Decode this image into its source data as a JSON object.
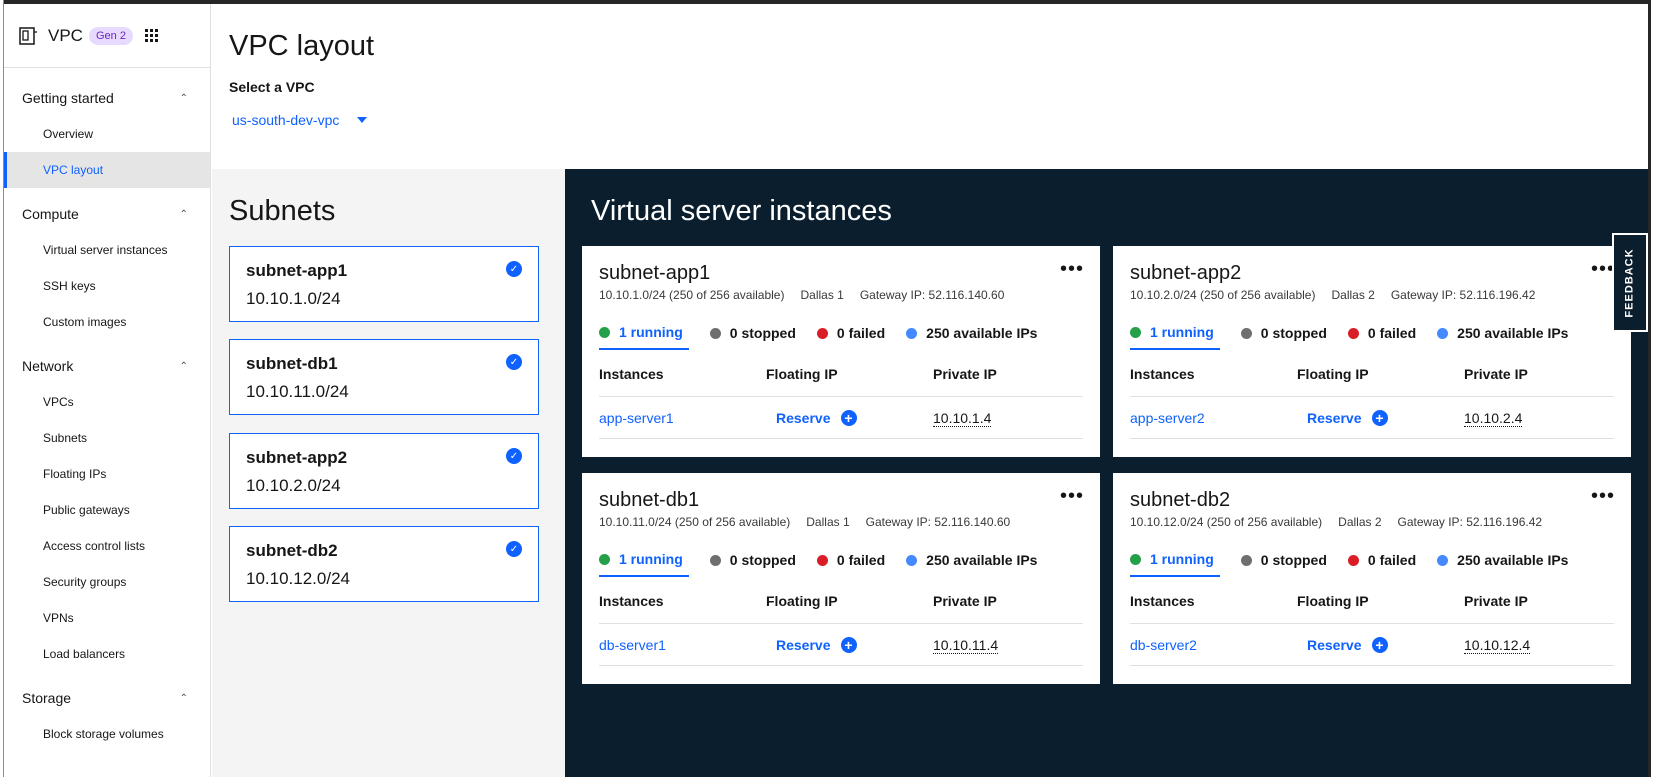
{
  "app": {
    "title": "VPC",
    "badge": "Gen 2"
  },
  "sidebar": {
    "sections": [
      {
        "label": "Getting started",
        "items": [
          {
            "label": "Overview"
          },
          {
            "label": "VPC layout"
          }
        ]
      },
      {
        "label": "Compute",
        "items": [
          {
            "label": "Virtual server instances"
          },
          {
            "label": "SSH keys"
          },
          {
            "label": "Custom images"
          }
        ]
      },
      {
        "label": "Network",
        "items": [
          {
            "label": "VPCs"
          },
          {
            "label": "Subnets"
          },
          {
            "label": "Floating IPs"
          },
          {
            "label": "Public gateways"
          },
          {
            "label": "Access control lists"
          },
          {
            "label": "Security groups"
          },
          {
            "label": "VPNs"
          },
          {
            "label": "Load balancers"
          }
        ]
      },
      {
        "label": "Storage",
        "items": [
          {
            "label": "Block storage volumes"
          }
        ]
      }
    ],
    "active_item": "VPC layout"
  },
  "page": {
    "title": "VPC layout",
    "select_label": "Select a VPC",
    "selected_vpc": "us-south-dev-vpc"
  },
  "subnets": {
    "title": "Subnets",
    "items": [
      {
        "name": "subnet-app1",
        "cidr": "10.10.1.0/24"
      },
      {
        "name": "subnet-db1",
        "cidr": "10.10.11.0/24"
      },
      {
        "name": "subnet-app2",
        "cidr": "10.10.2.0/24"
      },
      {
        "name": "subnet-db2",
        "cidr": "10.10.12.0/24"
      }
    ]
  },
  "vsi": {
    "title": "Virtual server instances",
    "table_headers": {
      "instances": "Instances",
      "floating_ip": "Floating IP",
      "private_ip": "Private IP"
    },
    "reserve_label": "Reserve",
    "cards": [
      {
        "name": "subnet-app1",
        "cidr": "10.10.1.0/24 (250 of 256 available)",
        "zone": "Dallas 1",
        "gateway": "Gateway IP: 52.116.140.60",
        "running": "1 running",
        "stopped": "0 stopped",
        "failed": "0 failed",
        "available": "250 available IPs",
        "instance": "app-server1",
        "private_ip": "10.10.1.4"
      },
      {
        "name": "subnet-app2",
        "cidr": "10.10.2.0/24 (250 of 256 available)",
        "zone": "Dallas 2",
        "gateway": "Gateway IP: 52.116.196.42",
        "running": "1 running",
        "stopped": "0 stopped",
        "failed": "0 failed",
        "available": "250 available IPs",
        "instance": "app-server2",
        "private_ip": "10.10.2.4"
      },
      {
        "name": "subnet-db1",
        "cidr": "10.10.11.0/24 (250 of 256 available)",
        "zone": "Dallas 1",
        "gateway": "Gateway IP: 52.116.140.60",
        "running": "1 running",
        "stopped": "0 stopped",
        "failed": "0 failed",
        "available": "250 available IPs",
        "instance": "db-server1",
        "private_ip": "10.10.11.4"
      },
      {
        "name": "subnet-db2",
        "cidr": "10.10.12.0/24 (250 of 256 available)",
        "zone": "Dallas 2",
        "gateway": "Gateway IP: 52.116.196.42",
        "running": "1 running",
        "stopped": "0 stopped",
        "failed": "0 failed",
        "available": "250 available IPs",
        "instance": "db-server2",
        "private_ip": "10.10.12.4"
      }
    ]
  },
  "feedback": {
    "label": "FEEDBACK"
  },
  "colors": {
    "accent": "#0f62fe",
    "running": "#24a148",
    "stopped": "#6f6f6f",
    "failed": "#da1e28",
    "available": "#4589ff",
    "dark_panel": "#0b1e2d",
    "badge_bg": "#e8daff"
  },
  "icons": {
    "vpc": "vpc-icon",
    "app_switcher": "app-switcher-icon",
    "chevron": "chevron-up-icon",
    "check": "checkmark-filled-icon",
    "overflow": "overflow-menu-icon",
    "add": "add-filled-icon"
  }
}
